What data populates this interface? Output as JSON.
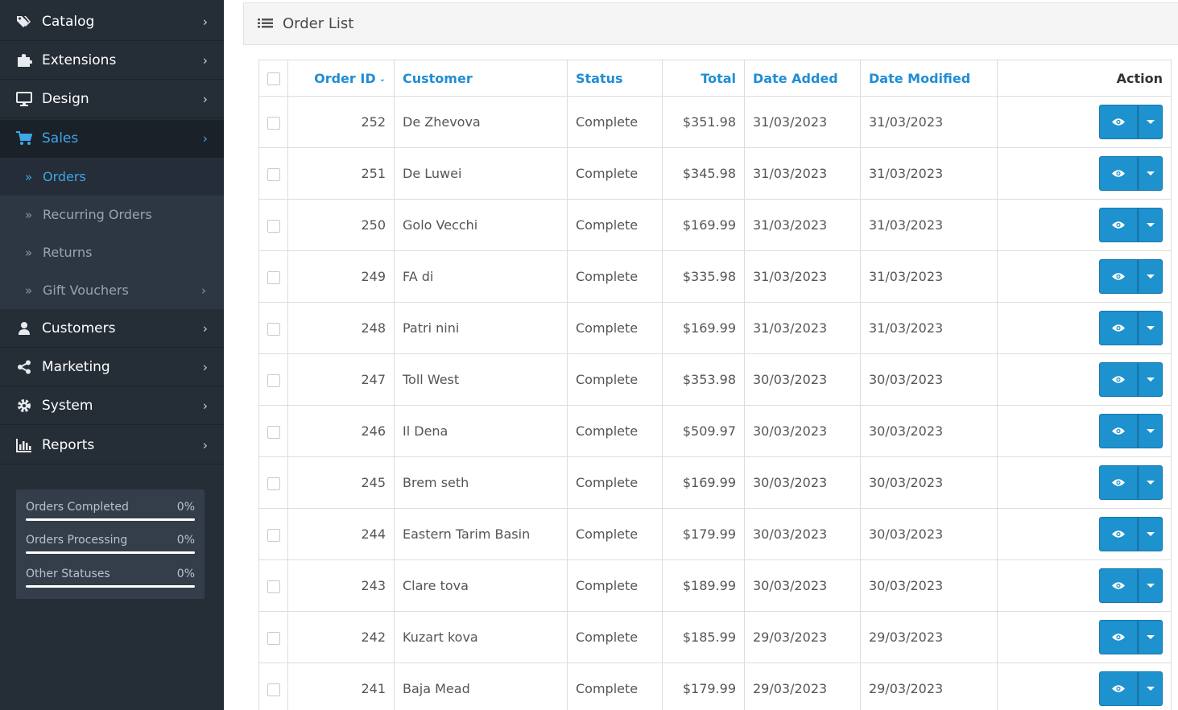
{
  "sidebar": {
    "nav": [
      {
        "label": "Catalog",
        "icon": "tags-icon"
      },
      {
        "label": "Extensions",
        "icon": "puzzle-icon"
      },
      {
        "label": "Design",
        "icon": "desktop-icon"
      },
      {
        "label": "Sales",
        "icon": "shopping-cart-icon",
        "active": true
      }
    ],
    "sales_submenu": [
      {
        "label": "Orders",
        "active": true
      },
      {
        "label": "Recurring Orders"
      },
      {
        "label": "Returns"
      },
      {
        "label": "Gift Vouchers",
        "has_children": true
      }
    ],
    "nav_bottom": [
      {
        "label": "Customers",
        "icon": "user-icon"
      },
      {
        "label": "Marketing",
        "icon": "share-icon"
      },
      {
        "label": "System",
        "icon": "cog-icon"
      },
      {
        "label": "Reports",
        "icon": "bar-chart-icon"
      }
    ],
    "stats": [
      {
        "label": "Orders Completed",
        "value": "0%",
        "fraction": 0
      },
      {
        "label": "Orders Processing",
        "value": "0%",
        "fraction": 0
      },
      {
        "label": "Other Statuses",
        "value": "0%",
        "fraction": 0
      }
    ]
  },
  "panel": {
    "title": "Order List"
  },
  "table": {
    "headers": {
      "order_id": "Order ID",
      "customer": "Customer",
      "status": "Status",
      "total": "Total",
      "date_added": "Date Added",
      "date_modified": "Date Modified",
      "action": "Action"
    },
    "rows": [
      {
        "id": "252",
        "customer": "De Zhevova",
        "status": "Complete",
        "total": "$351.98",
        "added": "31/03/2023",
        "modified": "31/03/2023"
      },
      {
        "id": "251",
        "customer": "De Luwei",
        "status": "Complete",
        "total": "$345.98",
        "added": "31/03/2023",
        "modified": "31/03/2023"
      },
      {
        "id": "250",
        "customer": "Golo Vecchi",
        "status": "Complete",
        "total": "$169.99",
        "added": "31/03/2023",
        "modified": "31/03/2023"
      },
      {
        "id": "249",
        "customer": "FA di",
        "status": "Complete",
        "total": "$335.98",
        "added": "31/03/2023",
        "modified": "31/03/2023"
      },
      {
        "id": "248",
        "customer": "Patri nini",
        "status": "Complete",
        "total": "$169.99",
        "added": "31/03/2023",
        "modified": "31/03/2023"
      },
      {
        "id": "247",
        "customer": "Toll West",
        "status": "Complete",
        "total": "$353.98",
        "added": "30/03/2023",
        "modified": "30/03/2023"
      },
      {
        "id": "246",
        "customer": "Il Dena",
        "status": "Complete",
        "total": "$509.97",
        "added": "30/03/2023",
        "modified": "30/03/2023"
      },
      {
        "id": "245",
        "customer": "Brem seth",
        "status": "Complete",
        "total": "$169.99",
        "added": "30/03/2023",
        "modified": "30/03/2023"
      },
      {
        "id": "244",
        "customer": "Eastern Tarim Basin",
        "status": "Complete",
        "total": "$179.99",
        "added": "30/03/2023",
        "modified": "30/03/2023"
      },
      {
        "id": "243",
        "customer": "Clare tova",
        "status": "Complete",
        "total": "$189.99",
        "added": "30/03/2023",
        "modified": "30/03/2023"
      },
      {
        "id": "242",
        "customer": "Kuzart kova",
        "status": "Complete",
        "total": "$185.99",
        "added": "29/03/2023",
        "modified": "29/03/2023"
      },
      {
        "id": "241",
        "customer": "Baja Mead",
        "status": "Complete",
        "total": "$179.99",
        "added": "29/03/2023",
        "modified": "29/03/2023"
      }
    ]
  },
  "colors": {
    "sidebar_bg": "#252d37",
    "accent": "#1e91cf",
    "link": "#1f8ed4"
  }
}
